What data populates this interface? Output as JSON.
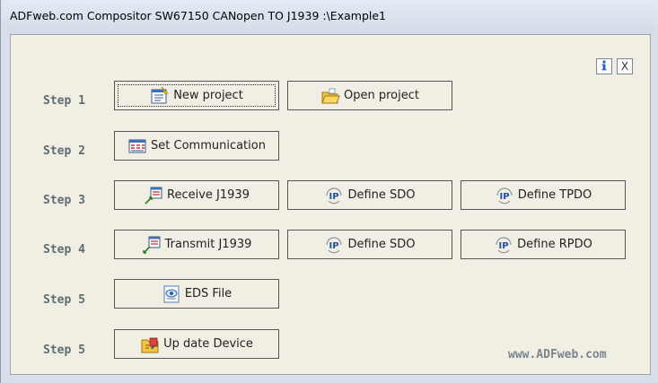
{
  "window": {
    "title": "ADFweb.com Compositor SW67150 CANopen TO J1939 :\\Example1"
  },
  "toolbar": {
    "info_icon": "info-icon",
    "close_label": "X"
  },
  "steps": [
    {
      "label": "Step 1"
    },
    {
      "label": "Step 2"
    },
    {
      "label": "Step 3"
    },
    {
      "label": "Step 4"
    },
    {
      "label": "Step 5"
    },
    {
      "label": "Step 5"
    }
  ],
  "buttons": {
    "new_project": {
      "label": "New project",
      "icon": "new-project-icon"
    },
    "open_project": {
      "label": "Open project",
      "icon": "folder-open-icon"
    },
    "set_communication": {
      "label": "Set Communication",
      "icon": "communication-icon"
    },
    "receive_j1939": {
      "label": "Receive J1939",
      "icon": "receive-icon"
    },
    "define_sdo_3": {
      "label": "Define SDO",
      "icon": "ip-icon"
    },
    "define_tpdo": {
      "label": "Define TPDO",
      "icon": "ip-icon"
    },
    "transmit_j1939": {
      "label": "Transmit J1939",
      "icon": "transmit-icon"
    },
    "define_sdo_4": {
      "label": "Define SDO",
      "icon": "ip-icon"
    },
    "define_rpdo": {
      "label": "Define RPDO",
      "icon": "ip-icon"
    },
    "eds_file": {
      "label": "EDS File",
      "icon": "eds-file-icon"
    },
    "update_device": {
      "label": "Up date Device",
      "icon": "update-device-icon"
    }
  },
  "footer": {
    "website": "www.ADFweb.com"
  },
  "colors": {
    "client_bg": "#f1efe3",
    "step_text": "#5e6b75",
    "button_border": "#555555",
    "footer_text": "#7b858e"
  }
}
